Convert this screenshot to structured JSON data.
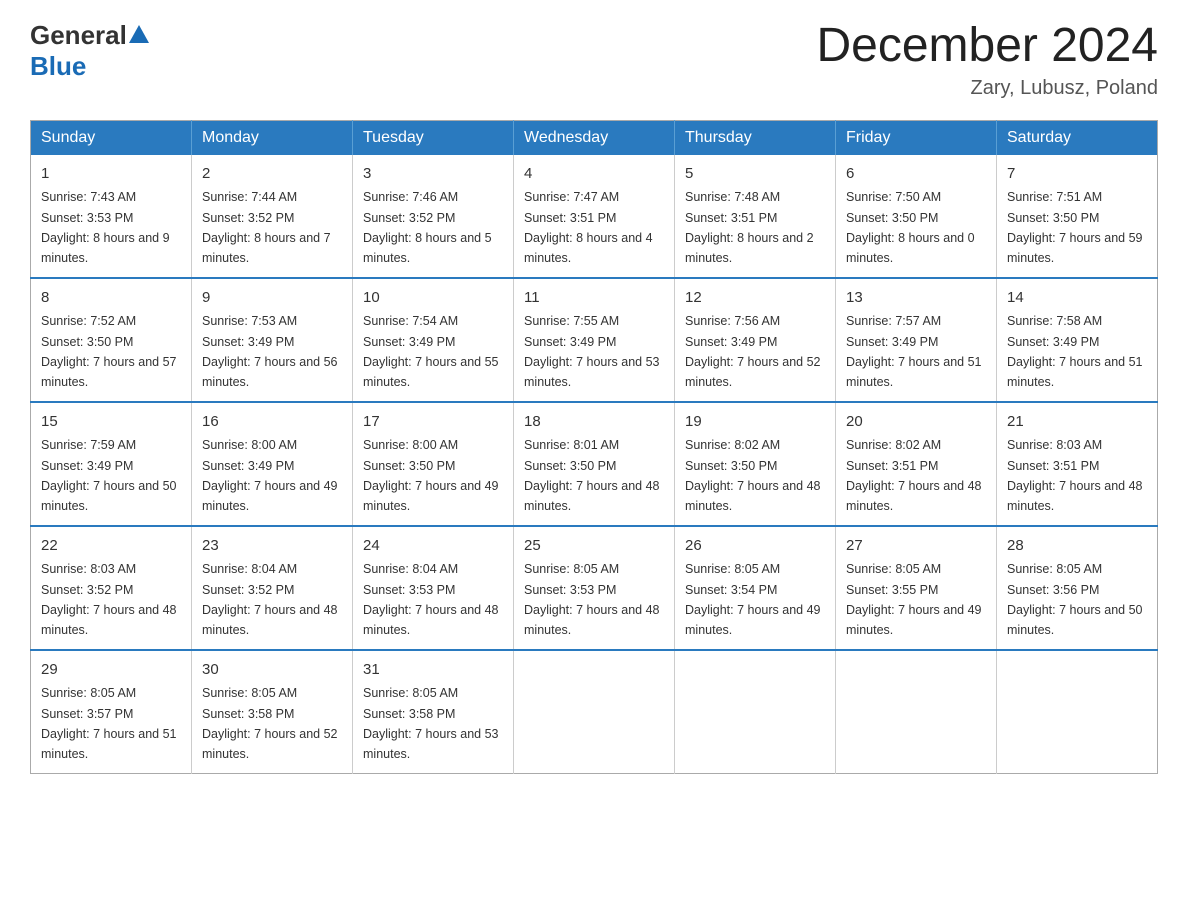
{
  "logo": {
    "general": "General",
    "blue": "Blue"
  },
  "title": {
    "month": "December 2024",
    "location": "Zary, Lubusz, Poland"
  },
  "weekdays": [
    "Sunday",
    "Monday",
    "Tuesday",
    "Wednesday",
    "Thursday",
    "Friday",
    "Saturday"
  ],
  "weeks": [
    [
      {
        "day": "1",
        "sunrise": "7:43 AM",
        "sunset": "3:53 PM",
        "daylight": "8 hours and 9 minutes."
      },
      {
        "day": "2",
        "sunrise": "7:44 AM",
        "sunset": "3:52 PM",
        "daylight": "8 hours and 7 minutes."
      },
      {
        "day": "3",
        "sunrise": "7:46 AM",
        "sunset": "3:52 PM",
        "daylight": "8 hours and 5 minutes."
      },
      {
        "day": "4",
        "sunrise": "7:47 AM",
        "sunset": "3:51 PM",
        "daylight": "8 hours and 4 minutes."
      },
      {
        "day": "5",
        "sunrise": "7:48 AM",
        "sunset": "3:51 PM",
        "daylight": "8 hours and 2 minutes."
      },
      {
        "day": "6",
        "sunrise": "7:50 AM",
        "sunset": "3:50 PM",
        "daylight": "8 hours and 0 minutes."
      },
      {
        "day": "7",
        "sunrise": "7:51 AM",
        "sunset": "3:50 PM",
        "daylight": "7 hours and 59 minutes."
      }
    ],
    [
      {
        "day": "8",
        "sunrise": "7:52 AM",
        "sunset": "3:50 PM",
        "daylight": "7 hours and 57 minutes."
      },
      {
        "day": "9",
        "sunrise": "7:53 AM",
        "sunset": "3:49 PM",
        "daylight": "7 hours and 56 minutes."
      },
      {
        "day": "10",
        "sunrise": "7:54 AM",
        "sunset": "3:49 PM",
        "daylight": "7 hours and 55 minutes."
      },
      {
        "day": "11",
        "sunrise": "7:55 AM",
        "sunset": "3:49 PM",
        "daylight": "7 hours and 53 minutes."
      },
      {
        "day": "12",
        "sunrise": "7:56 AM",
        "sunset": "3:49 PM",
        "daylight": "7 hours and 52 minutes."
      },
      {
        "day": "13",
        "sunrise": "7:57 AM",
        "sunset": "3:49 PM",
        "daylight": "7 hours and 51 minutes."
      },
      {
        "day": "14",
        "sunrise": "7:58 AM",
        "sunset": "3:49 PM",
        "daylight": "7 hours and 51 minutes."
      }
    ],
    [
      {
        "day": "15",
        "sunrise": "7:59 AM",
        "sunset": "3:49 PM",
        "daylight": "7 hours and 50 minutes."
      },
      {
        "day": "16",
        "sunrise": "8:00 AM",
        "sunset": "3:49 PM",
        "daylight": "7 hours and 49 minutes."
      },
      {
        "day": "17",
        "sunrise": "8:00 AM",
        "sunset": "3:50 PM",
        "daylight": "7 hours and 49 minutes."
      },
      {
        "day": "18",
        "sunrise": "8:01 AM",
        "sunset": "3:50 PM",
        "daylight": "7 hours and 48 minutes."
      },
      {
        "day": "19",
        "sunrise": "8:02 AM",
        "sunset": "3:50 PM",
        "daylight": "7 hours and 48 minutes."
      },
      {
        "day": "20",
        "sunrise": "8:02 AM",
        "sunset": "3:51 PM",
        "daylight": "7 hours and 48 minutes."
      },
      {
        "day": "21",
        "sunrise": "8:03 AM",
        "sunset": "3:51 PM",
        "daylight": "7 hours and 48 minutes."
      }
    ],
    [
      {
        "day": "22",
        "sunrise": "8:03 AM",
        "sunset": "3:52 PM",
        "daylight": "7 hours and 48 minutes."
      },
      {
        "day": "23",
        "sunrise": "8:04 AM",
        "sunset": "3:52 PM",
        "daylight": "7 hours and 48 minutes."
      },
      {
        "day": "24",
        "sunrise": "8:04 AM",
        "sunset": "3:53 PM",
        "daylight": "7 hours and 48 minutes."
      },
      {
        "day": "25",
        "sunrise": "8:05 AM",
        "sunset": "3:53 PM",
        "daylight": "7 hours and 48 minutes."
      },
      {
        "day": "26",
        "sunrise": "8:05 AM",
        "sunset": "3:54 PM",
        "daylight": "7 hours and 49 minutes."
      },
      {
        "day": "27",
        "sunrise": "8:05 AM",
        "sunset": "3:55 PM",
        "daylight": "7 hours and 49 minutes."
      },
      {
        "day": "28",
        "sunrise": "8:05 AM",
        "sunset": "3:56 PM",
        "daylight": "7 hours and 50 minutes."
      }
    ],
    [
      {
        "day": "29",
        "sunrise": "8:05 AM",
        "sunset": "3:57 PM",
        "daylight": "7 hours and 51 minutes."
      },
      {
        "day": "30",
        "sunrise": "8:05 AM",
        "sunset": "3:58 PM",
        "daylight": "7 hours and 52 minutes."
      },
      {
        "day": "31",
        "sunrise": "8:05 AM",
        "sunset": "3:58 PM",
        "daylight": "7 hours and 53 minutes."
      },
      null,
      null,
      null,
      null
    ]
  ]
}
